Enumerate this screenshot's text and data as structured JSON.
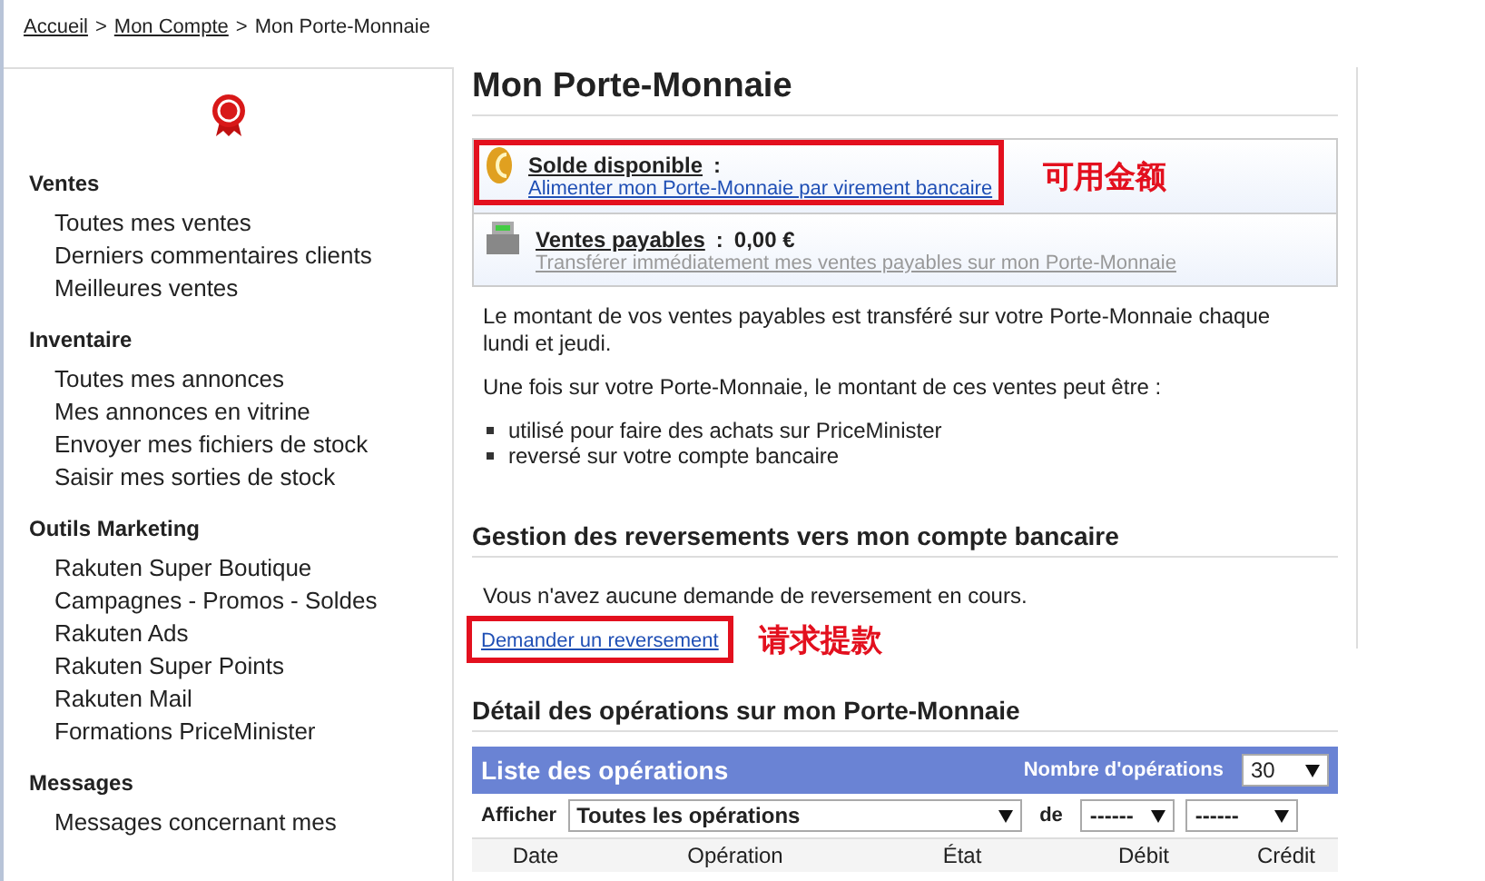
{
  "breadcrumb": [
    {
      "label": "Accueil",
      "link": true
    },
    {
      "label": "Mon Compte",
      "link": true
    },
    {
      "label": "Mon Porte-Monnaie",
      "link": false
    }
  ],
  "breadcrumb_separator": ">",
  "sidebar": {
    "sections": [
      {
        "title": "Ventes",
        "items": [
          "Toutes mes ventes",
          "Derniers commentaires clients",
          "Meilleures ventes"
        ]
      },
      {
        "title": "Inventaire",
        "items": [
          "Toutes mes annonces",
          "Mes annonces en vitrine",
          "Envoyer mes fichiers de stock",
          "Saisir mes sorties de stock"
        ]
      },
      {
        "title": "Outils Marketing",
        "items": [
          "Rakuten Super Boutique",
          "Campagnes - Promos - Soldes",
          "Rakuten Ads",
          "Rakuten Super Points",
          "Rakuten Mail",
          "Formations PriceMinister"
        ]
      },
      {
        "title": "Messages",
        "items": [
          "Messages concernant mes"
        ]
      }
    ]
  },
  "page_title": "Mon Porte-Monnaie",
  "wallet": [
    {
      "kind": "balance",
      "label": "Solde disponible",
      "colon": ":",
      "link": "Alimenter mon Porte-Monnaie par virement bancaire",
      "highlighted": true,
      "annotation": "可用金额"
    },
    {
      "kind": "payable",
      "label": "Ventes payables",
      "colon": ":",
      "value": "0,00 €",
      "link": "Transférer immédiatement mes ventes payables sur mon Porte-Monnaie",
      "highlighted": false
    }
  ],
  "info": [
    "Le montant de vos ventes payables est transféré sur votre Porte-Monnaie chaque lundi et jeudi.",
    "Une fois sur votre Porte-Monnaie, le montant de ces ventes peut être :"
  ],
  "info_list": [
    "utilisé pour faire des achats sur PriceMinister",
    "reversé sur votre compte bancaire"
  ],
  "transfers": {
    "title": "Gestion des reversements vers mon compte bancaire",
    "message": "Vous n'avez aucune demande de reversement en cours.",
    "request_link": "Demander un reversement",
    "highlighted": true,
    "annotation": "请求提款"
  },
  "operations": {
    "title": "Détail des opérations sur mon Porte-Monnaie",
    "panel_title": "Liste des opérations",
    "count_label": "Nombre d'opérations",
    "count_value": "30",
    "filter_label": "Afficher",
    "filter_value": "Toutes les opérations",
    "from_label": "de",
    "from_month": "------",
    "from_year": "------",
    "columns": [
      "Date",
      "Opération",
      "État",
      "Débit",
      "Crédit"
    ]
  }
}
